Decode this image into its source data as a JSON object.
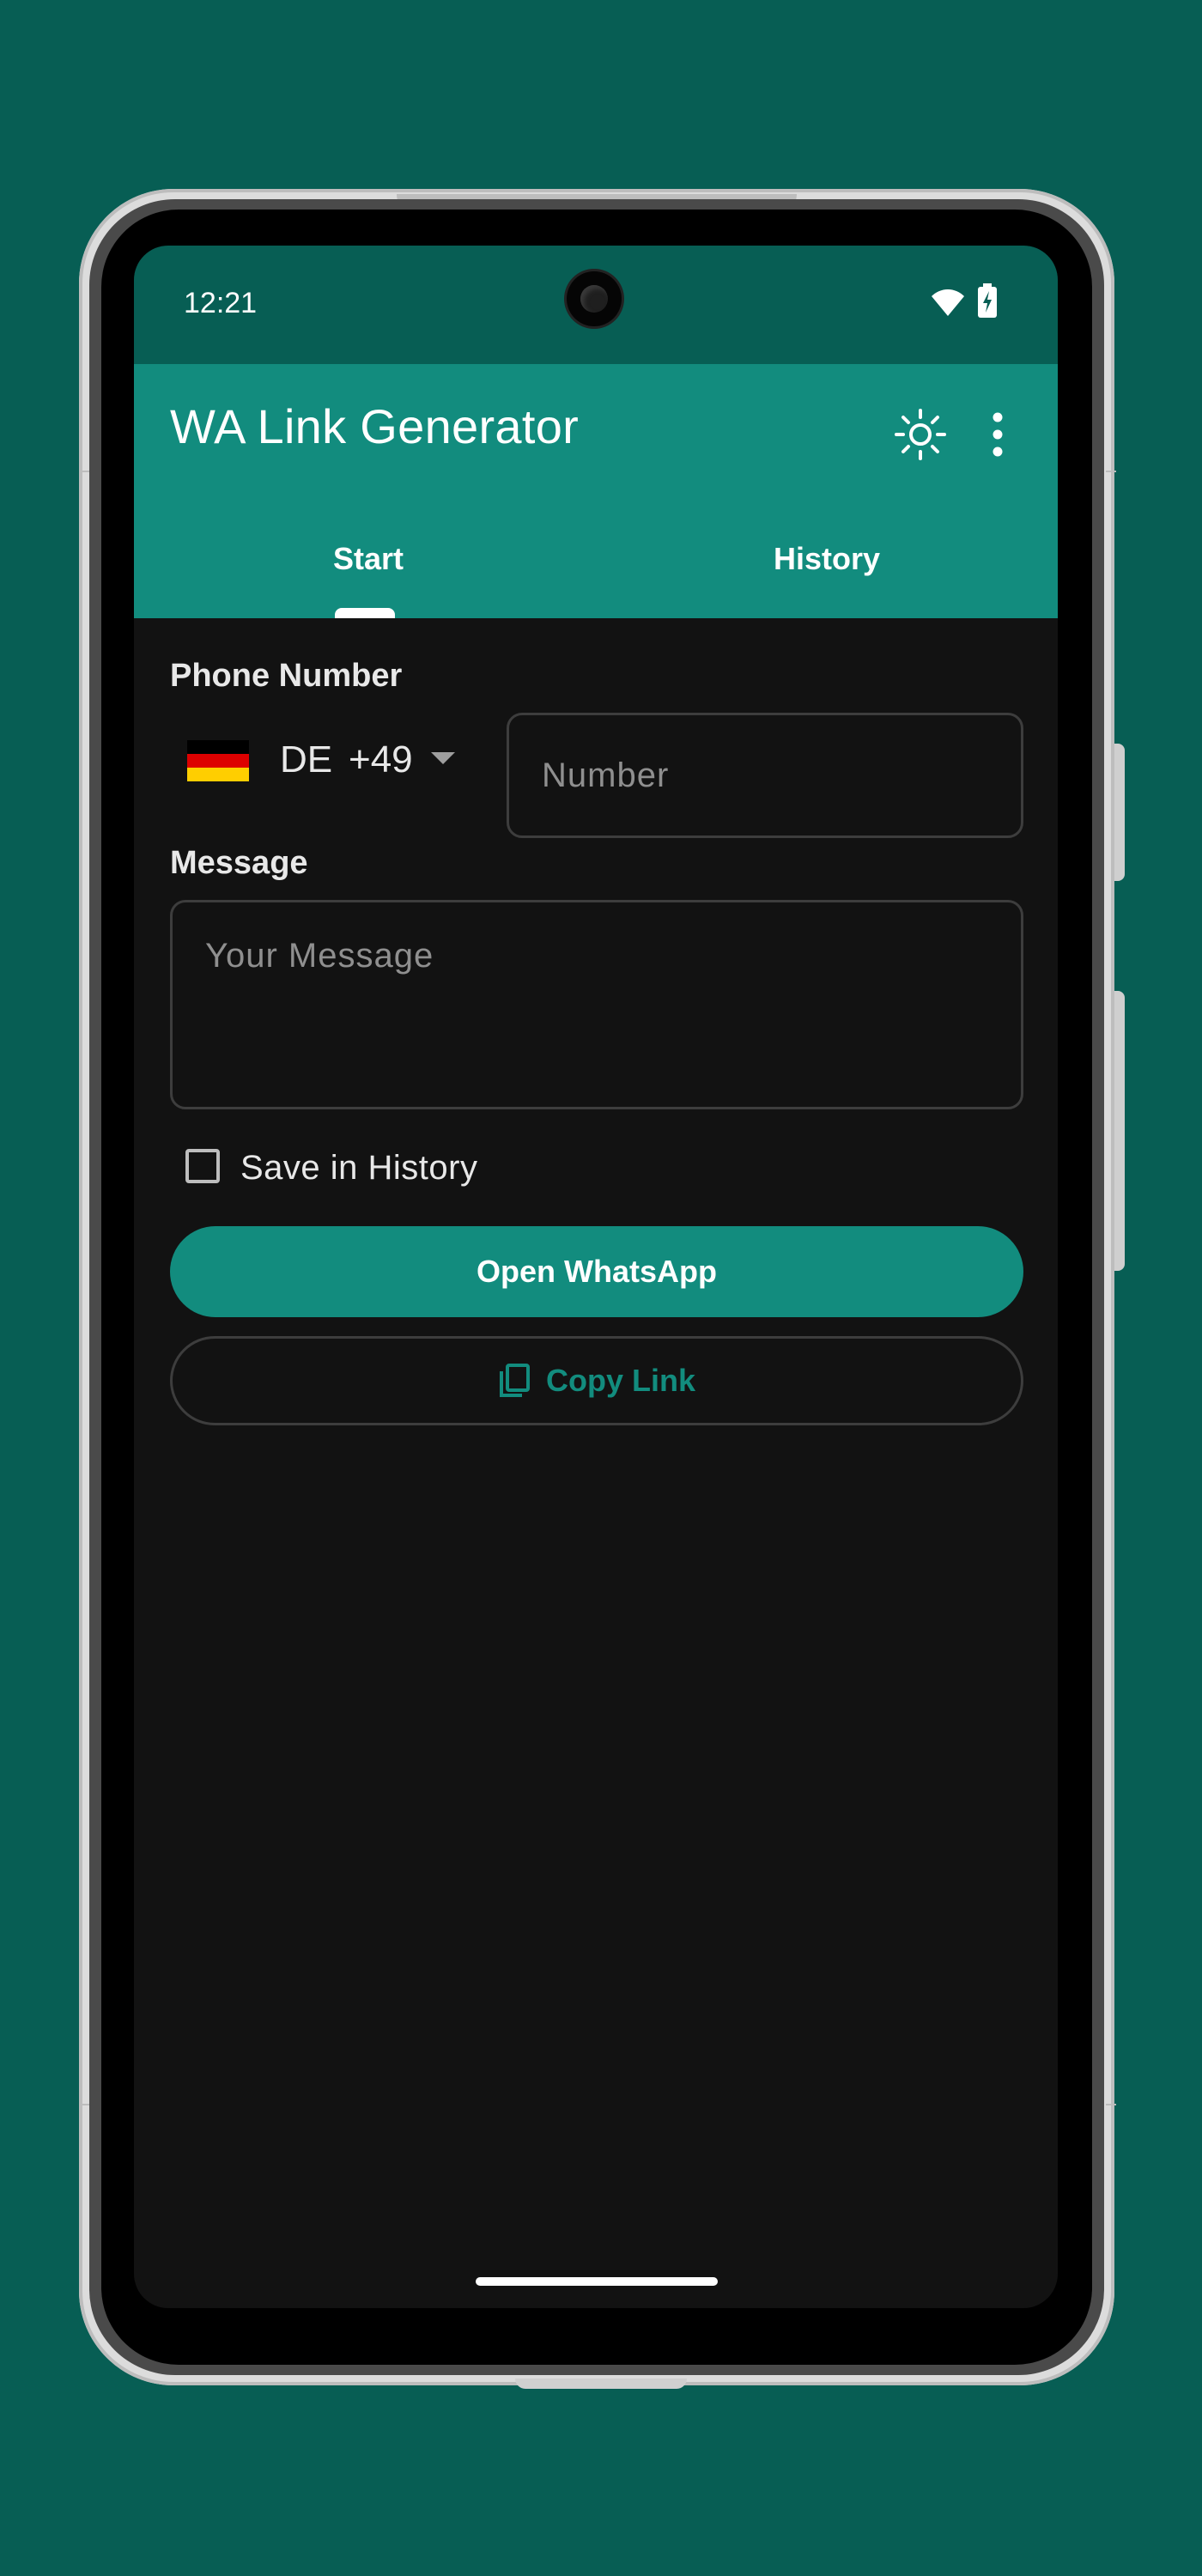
{
  "status_bar": {
    "time": "12:21",
    "icons": [
      "wifi-icon",
      "battery-charging-icon"
    ]
  },
  "app_bar": {
    "title": "WA Link Generator",
    "actions": [
      "theme-toggle-icon",
      "more-vert-icon"
    ],
    "background_color": "#128c7e"
  },
  "tabs": [
    {
      "label": "Start",
      "selected": true
    },
    {
      "label": "History",
      "selected": false
    }
  ],
  "form": {
    "phone_label": "Phone Number",
    "country": {
      "flag": "germany-flag",
      "code": "DE",
      "dial_code": "+49"
    },
    "number_placeholder": "Number",
    "number_value": "",
    "message_label": "Message",
    "message_placeholder": "Your Message",
    "message_value": "",
    "save_history_label": "Save in History",
    "save_history_checked": false
  },
  "buttons": {
    "open_whatsapp": "Open WhatsApp",
    "copy_link": "Copy Link"
  },
  "colors": {
    "accent": "#128c7e",
    "status_bar": "#075e54",
    "background": "#121212"
  }
}
